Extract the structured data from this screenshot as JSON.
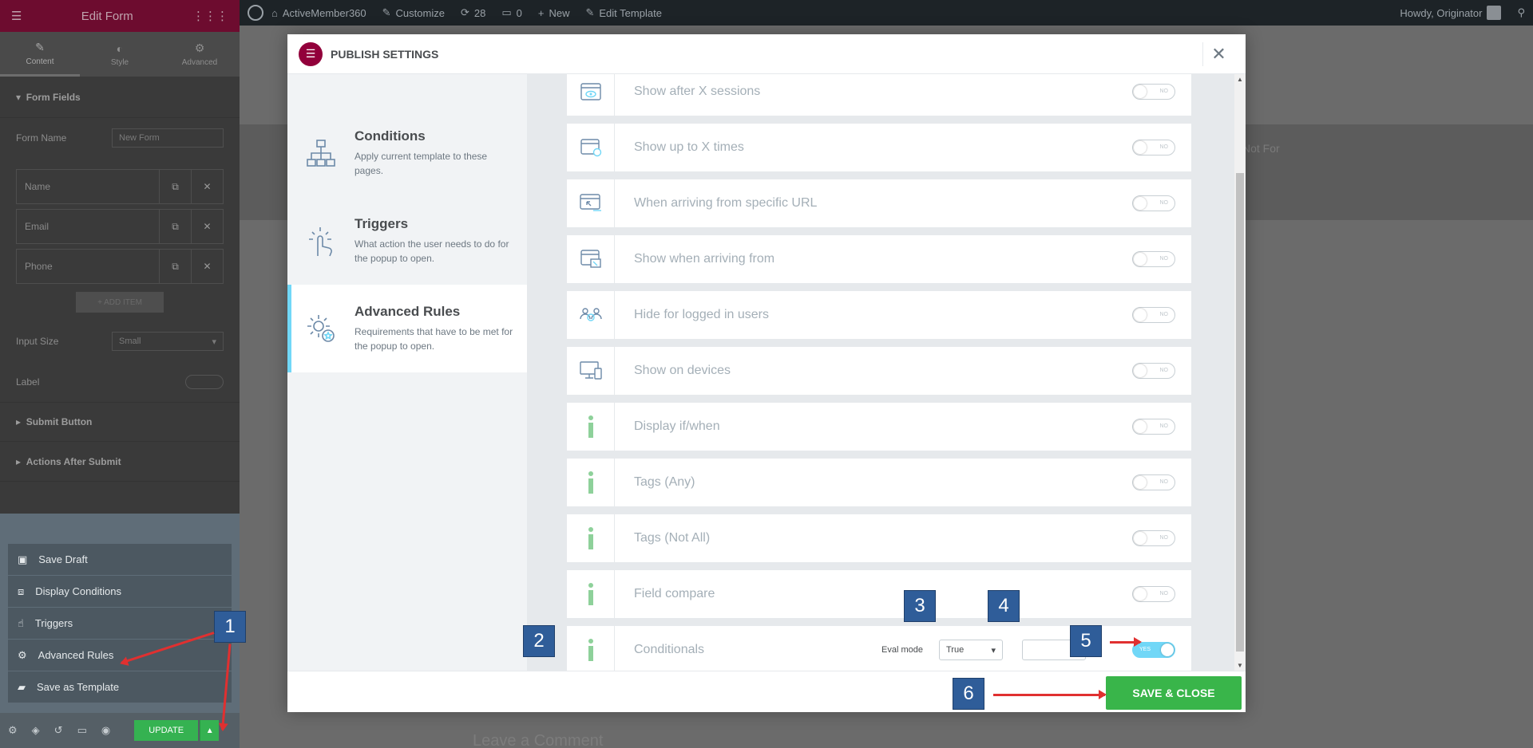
{
  "admin_bar": {
    "site_name": "ActiveMember360",
    "customize": "Customize",
    "updates": "28",
    "comments": "0",
    "new": "New",
    "edit_template": "Edit Template",
    "howdy": "Howdy, Originator"
  },
  "panel": {
    "title": "Edit Form",
    "tabs": [
      {
        "label": "Content",
        "icon": "pencil-icon"
      },
      {
        "label": "Style",
        "icon": "half-circle-icon"
      },
      {
        "label": "Advanced",
        "icon": "gear-icon"
      }
    ],
    "section_form_fields": "Form Fields",
    "form_name_label": "Form Name",
    "form_name_value": "New Form",
    "fields": [
      "Name",
      "Email",
      "Phone"
    ],
    "add_item": "+ ADD ITEM",
    "input_size_label": "Input Size",
    "input_size_value": "Small",
    "label_label": "Label",
    "section_submit": "Submit Button",
    "section_actions": "Actions After Submit"
  },
  "save_menu": {
    "items": [
      {
        "label": "Save Draft",
        "icon": "save-icon"
      },
      {
        "label": "Display Conditions",
        "icon": "sitemap-icon"
      },
      {
        "label": "Triggers",
        "icon": "hand-pointer-icon"
      },
      {
        "label": "Advanced Rules",
        "icon": "cog-icon"
      },
      {
        "label": "Save as Template",
        "icon": "folder-icon"
      }
    ],
    "update": "UPDATE"
  },
  "preview": {
    "band_text": "Not For",
    "comment_heading": "Leave a Comment"
  },
  "modal": {
    "title": "PUBLISH SETTINGS",
    "nav": [
      {
        "title": "Conditions",
        "desc": "Apply current template to these pages.",
        "icon": "sitemap-icon"
      },
      {
        "title": "Triggers",
        "desc": "What action the user needs to do for the popup to open.",
        "icon": "hand-pointer-icon"
      },
      {
        "title": "Advanced Rules",
        "desc": "Requirements that have to be met for the popup to open.",
        "icon": "cog-icon"
      }
    ],
    "active_nav": "Advanced Rules",
    "rules": [
      {
        "label": "Show after X sessions",
        "icon": "eye-window-icon",
        "state": "NO"
      },
      {
        "label": "Show up to X times",
        "icon": "window-user-icon",
        "state": "NO"
      },
      {
        "label": "When arriving from specific URL",
        "icon": "window-cursor-icon",
        "state": "NO"
      },
      {
        "label": "Show when arriving from",
        "icon": "window-arrow-icon",
        "state": "NO"
      },
      {
        "label": "Hide for logged in users",
        "icon": "users-icon",
        "state": "NO"
      },
      {
        "label": "Show on devices",
        "icon": "devices-icon",
        "state": "NO"
      },
      {
        "label": "Display if/when",
        "icon": "info-icon",
        "state": "NO"
      },
      {
        "label": "Tags (Any)",
        "icon": "info-icon",
        "state": "NO"
      },
      {
        "label": "Tags (Not All)",
        "icon": "info-icon",
        "state": "NO"
      },
      {
        "label": "Field compare",
        "icon": "info-icon",
        "state": "NO"
      }
    ],
    "conditionals": {
      "label": "Conditionals",
      "eval_label": "Eval mode",
      "eval_value": "True",
      "second_value": "",
      "state": "YES"
    },
    "save_close": "SAVE & CLOSE"
  },
  "markers": [
    "1",
    "2",
    "3",
    "4",
    "5",
    "6"
  ],
  "colors": {
    "elementor_brand": "#92003b",
    "accent_blue": "#71d7f7",
    "save_green": "#39b54a",
    "marker_blue": "#2f5d99",
    "arrow_red": "#e03030"
  }
}
